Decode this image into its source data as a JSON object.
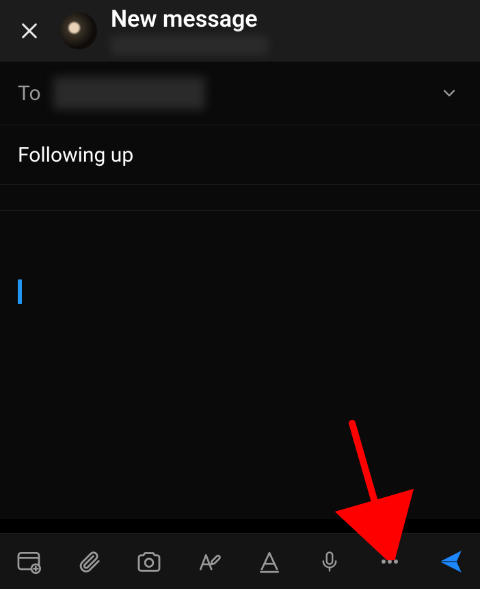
{
  "header": {
    "title": "New message"
  },
  "compose": {
    "to_label": "To",
    "subject": "Following up"
  },
  "icons": {
    "close": "close",
    "chevron_down": "chevron-down",
    "browser": "browser-add",
    "attach": "paperclip",
    "camera": "camera",
    "edit": "pencil-a",
    "format": "format-a",
    "mic": "microphone",
    "more": "more",
    "send": "send"
  },
  "colors": {
    "accent": "#1d87ff",
    "muted": "#9a9a9a",
    "annotation": "#ff0000"
  }
}
